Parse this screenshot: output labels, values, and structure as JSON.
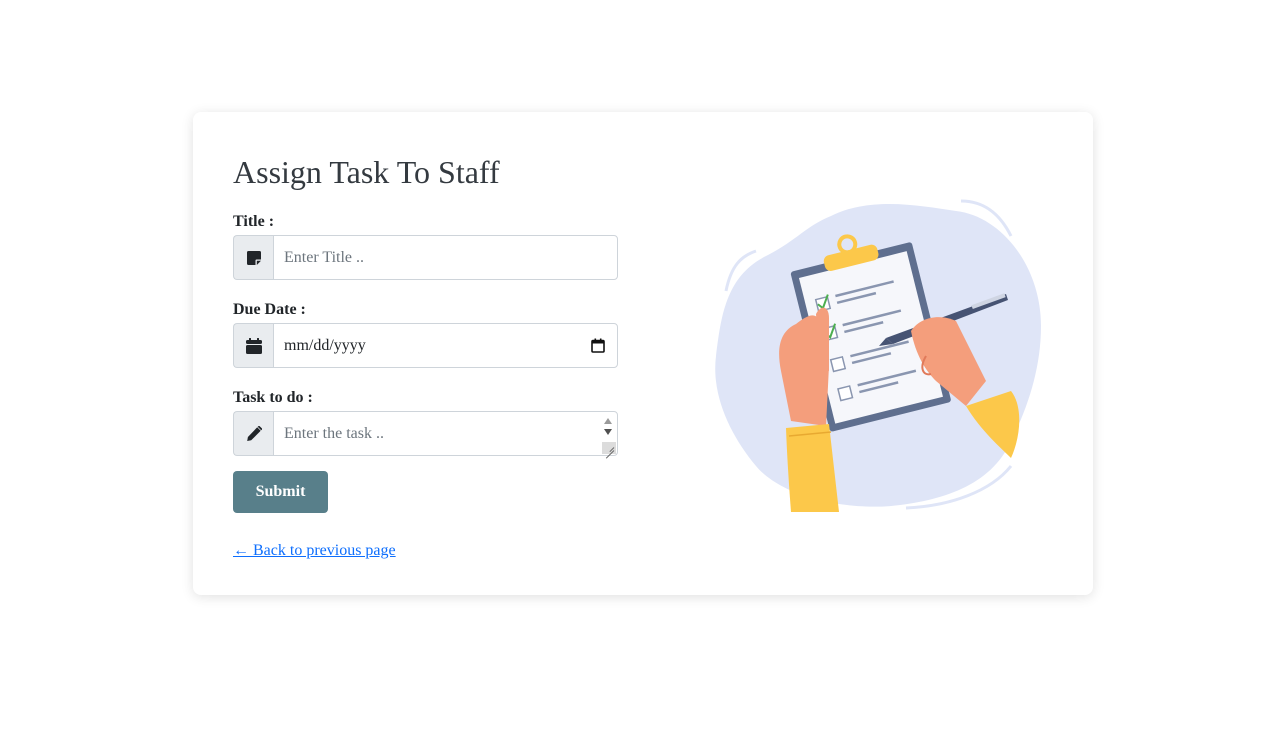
{
  "page": {
    "title": "Assign Task To Staff"
  },
  "form": {
    "title_label": "Title :",
    "title_placeholder": "Enter Title ..",
    "due_date_label": "Due Date :",
    "due_date_value": "mm/dd/yyyy",
    "task_label": "Task to do :",
    "task_placeholder": "Enter the task ..",
    "submit_label": "Submit"
  },
  "footer": {
    "back_link": "← Back to previous page"
  },
  "icons": {
    "title_prefix": "sticky-note-icon",
    "date_prefix": "calendar-icon",
    "task_prefix": "pencil-icon",
    "date_picker": "calendar-picker-icon"
  },
  "colors": {
    "submit_bg": "#587f8a",
    "link": "#0d6efd",
    "addon_bg": "#e9ecef",
    "illustration_blob": "#dfe5f7",
    "sleeve": "#fcc84a",
    "skin": "#f49e7c",
    "clipboard": "#5f6f8f"
  }
}
